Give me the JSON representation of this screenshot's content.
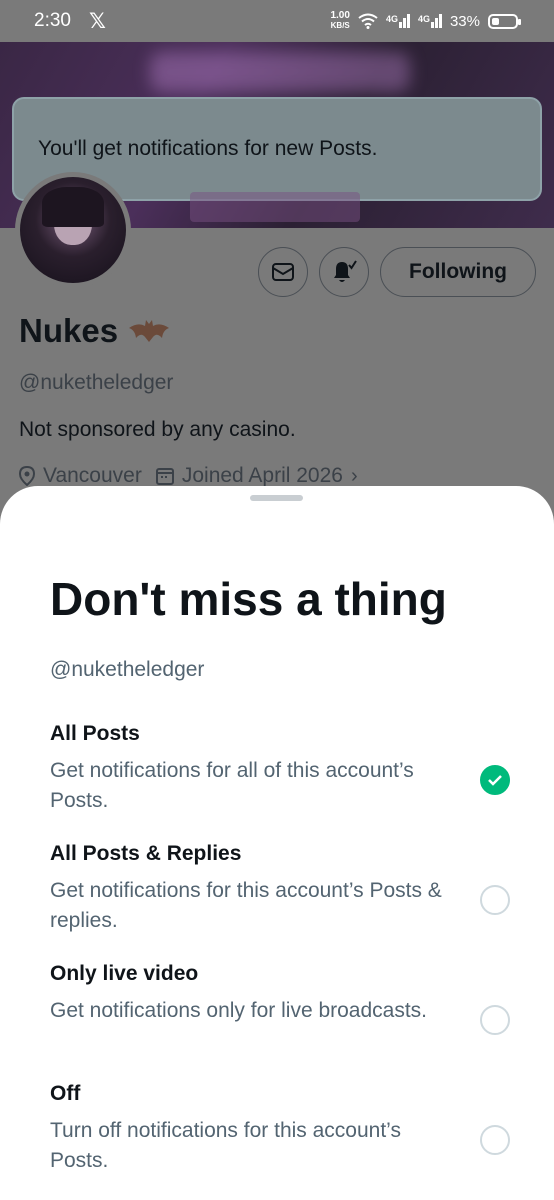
{
  "status_bar": {
    "time": "2:30",
    "app_icon": "x-logo-icon",
    "speed_value": "1.00",
    "speed_unit": "KB/S",
    "net1": "4G",
    "net2": "4G",
    "battery": "33%",
    "battery_level": 0.33
  },
  "toast": {
    "text": "You'll get notifications for new Posts."
  },
  "profile": {
    "name": "Nukes",
    "handle": "@nuketheledger",
    "bio": "Not sponsored by any casino.",
    "location": "Vancouver",
    "joined": "Joined April 2026",
    "following_label": "Following"
  },
  "sheet": {
    "title": "Don't miss a thing",
    "handle": "@nuketheledger",
    "options": [
      {
        "title": "All Posts",
        "desc": "Get notifications for all of this account’s Posts.",
        "selected": true
      },
      {
        "title": "All Posts & Replies",
        "desc": "Get notifications for this account’s Posts & replies.",
        "selected": false
      },
      {
        "title": "Only live video",
        "desc": "Get notifications only for live broadcasts.",
        "selected": false
      },
      {
        "title": "Off",
        "desc": "Turn off notifications for this account’s Posts.",
        "selected": false
      }
    ]
  },
  "colors": {
    "accent_green": "#00ba7c",
    "scrim": "#7a7a7a",
    "muted_text": "#536471"
  }
}
